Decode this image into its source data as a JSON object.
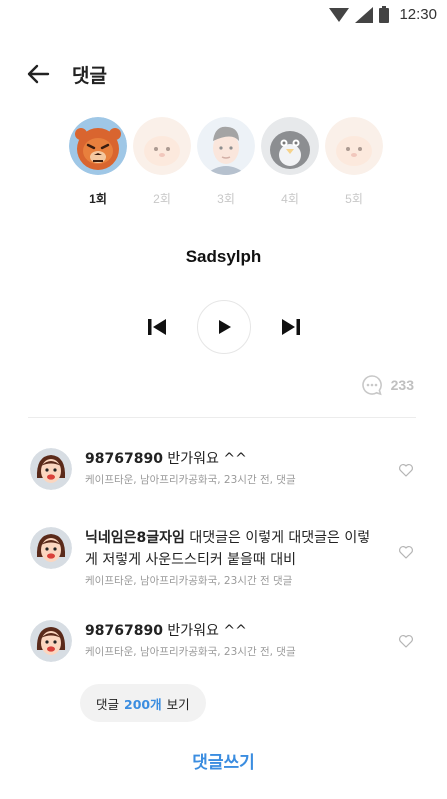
{
  "status": {
    "time": "12:30"
  },
  "header": {
    "title": "댓글"
  },
  "avatars": [
    {
      "label": "1회",
      "active": true
    },
    {
      "label": "2회",
      "active": false
    },
    {
      "label": "3회",
      "active": false
    },
    {
      "label": "4회",
      "active": false
    },
    {
      "label": "5회",
      "active": false
    }
  ],
  "player": {
    "title": "Sadsylph"
  },
  "comment_count": "233",
  "comments": [
    {
      "name": "98767890",
      "text": " 반가워요 ^^",
      "meta": "케이프타운, 남아프리카공화국, 23시간 전, 댓글"
    },
    {
      "name": "닉네임은8글자임",
      "text": " 대댓글은 이렇게 대댓글은 이렇게  저렇게 사운드스티커 붙을때 대비",
      "meta": "케이프타운, 남아프리카공화국, 23시간 전  댓글"
    },
    {
      "name": "98767890",
      "text": " 반가워요 ^^",
      "meta": "케이프타운, 남아프리카공화국, 23시간 전, 댓글"
    }
  ],
  "more": {
    "prefix": "댓글",
    "count": "200개",
    "suffix": "보기"
  },
  "write": {
    "label": "댓글쓰기"
  },
  "colors": {
    "accent": "#3b8de0",
    "muted": "#c0c0c0"
  }
}
